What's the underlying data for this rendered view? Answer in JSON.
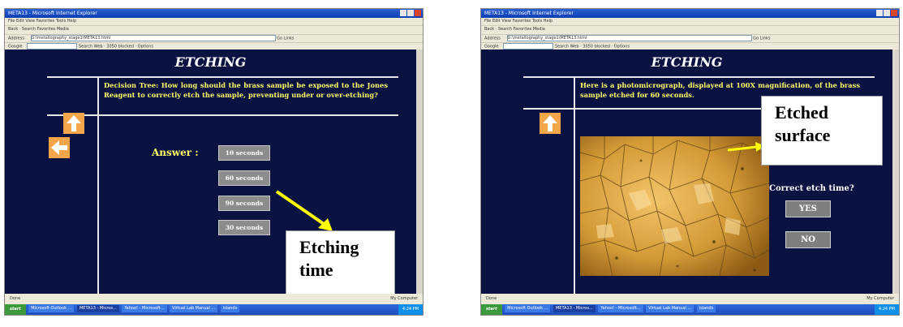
{
  "browser": {
    "title": "META13 - Microsoft Internet Explorer",
    "menu": "File  Edit  View  Favorites  Tools  Help",
    "toolbar": "Back  ·  Search  Favorites  Media",
    "address_label": "Address",
    "address_value": "G:\\metallography_stage1\\META13.html",
    "go_label": "Go",
    "links_label": "Links",
    "google_label": "Google",
    "google_toolbar": "Search Web  ·  3050 blocked  ·  Options",
    "status_left": "Done",
    "status_right": "My Computer",
    "taskbar": {
      "start": "start",
      "tasks": [
        "Microsoft Outlook ...",
        "META13 - Micros...",
        "Yahoo! - Microsoft...",
        "Virtual Lab Manual ...",
        "islands"
      ],
      "clock": "4:24 PM"
    }
  },
  "left_screen": {
    "title": "ETCHING",
    "question": "Decision Tree:  How long should the brass sample be exposed to the Jones Reagent to correctly etch the sample, preventing under or over-etching?",
    "answer_label": "Answer :",
    "options": [
      "10 seconds",
      "60 seconds",
      "90 seconds",
      "30 seconds"
    ],
    "callout": "Etching time",
    "icons": [
      "up-arrow-icon",
      "left-arrow-icon"
    ]
  },
  "right_screen": {
    "title": "ETCHING",
    "description": "Here is a photomicrograph, displayed at 100X magnification, of the brass sample etched for 60 seconds.",
    "question": "Correct etch time?",
    "yes_label": "YES",
    "no_label": "NO",
    "callout": "Etched surface",
    "icons": [
      "up-arrow-icon"
    ]
  },
  "colors": {
    "page_bg": "#0a1242",
    "question_text": "#ffff66",
    "nav_arrow": "#f5a64a",
    "pointer_arrow": "#ffff00"
  }
}
